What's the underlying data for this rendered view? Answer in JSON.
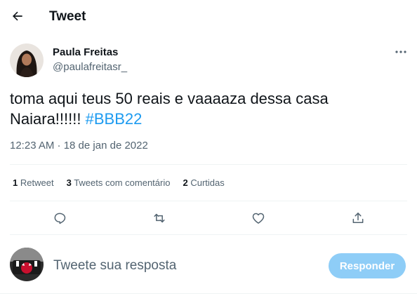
{
  "header": {
    "title": "Tweet",
    "back_icon": "arrow-left-icon"
  },
  "author": {
    "name": "Paula Freitas",
    "handle": "@paulafreitasr_"
  },
  "tweet": {
    "text_plain": "toma aqui teus 50 reais e vaaaaza dessa casa Naiara!!!!!!",
    "hashtag": "#BBB22",
    "timestamp": "12:23 AM · 18 de jan de 2022"
  },
  "stats": [
    {
      "count": "1",
      "label": "Retweet"
    },
    {
      "count": "3",
      "label": "Tweets com comentário"
    },
    {
      "count": "2",
      "label": "Curtidas"
    }
  ],
  "actions": [
    {
      "icon": "reply-icon"
    },
    {
      "icon": "retweet-icon"
    },
    {
      "icon": "heart-icon"
    },
    {
      "icon": "share-icon"
    }
  ],
  "reply": {
    "placeholder": "Tweete sua resposta",
    "button_label": "Responder"
  },
  "colors": {
    "accent": "#1d9bf0",
    "button_disabled": "#8ecdf7",
    "secondary_text": "#536471",
    "divider": "#eff3f4"
  }
}
